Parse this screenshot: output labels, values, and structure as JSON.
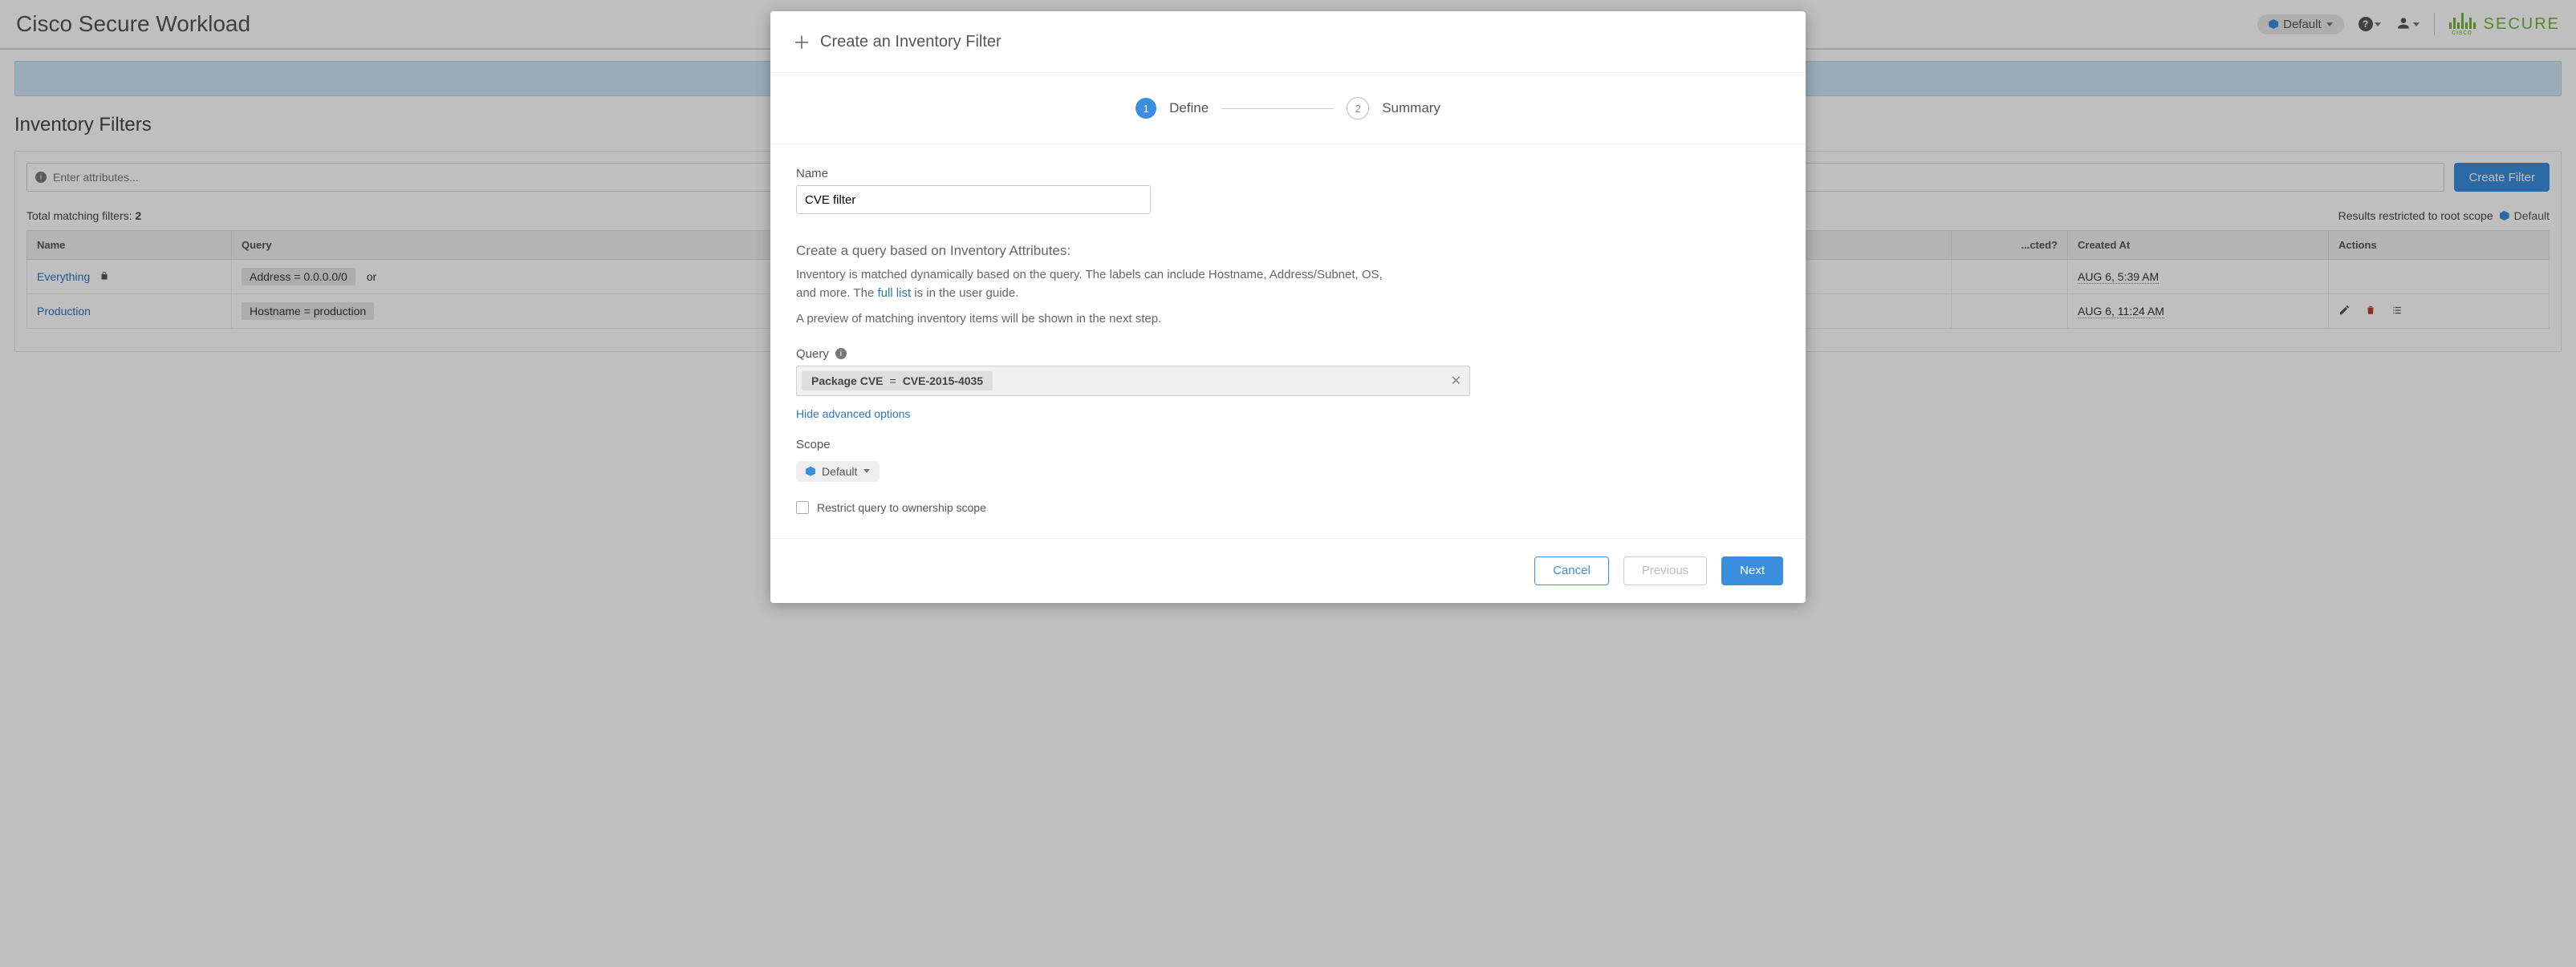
{
  "header": {
    "product": "Cisco Secure Workload",
    "scope": "Default",
    "secure_word": "SECURE",
    "cisco_word": "cisco"
  },
  "page": {
    "title": "Inventory Filters",
    "attr_placeholder": "Enter attributes...",
    "create_button": "Create Filter",
    "total_label": "Total matching filters: ",
    "total_count": "2",
    "results_label": "Results restricted to root scope",
    "results_scope": "Default"
  },
  "table": {
    "columns": {
      "name": "Name",
      "query": "Query",
      "restricted": "...cted?",
      "created": "Created At",
      "actions": "Actions"
    },
    "rows": [
      {
        "name": "Everything",
        "locked": true,
        "query_chips": [
          "Address = 0.0.0.0/0"
        ],
        "query_suffix": "or",
        "created": "AUG 6, 5:39 AM",
        "actions": false
      },
      {
        "name": "Production",
        "locked": false,
        "query_chips": [
          "Hostname = production"
        ],
        "query_suffix": "",
        "created": "AUG 6, 11:24 AM",
        "actions": true
      }
    ]
  },
  "modal": {
    "title": "Create an Inventory Filter",
    "steps": {
      "s1": "Define",
      "s2": "Summary",
      "n1": "1",
      "n2": "2"
    },
    "name_label": "Name",
    "name_value": "CVE filter",
    "section_head": "Create a query based on Inventory Attributes:",
    "explain1": "Inventory is matched dynamically based on the query. The labels can include Hostname, Address/Subnet, OS, and more. The ",
    "full_list": "full list",
    "explain2": " is in the user guide.",
    "preview": "A preview of matching inventory items will be shown in the next step.",
    "query_label": "Query",
    "token_key": "Package CVE",
    "token_op": "=",
    "token_val": "CVE-2015-4035",
    "advanced": "Hide advanced options",
    "scope_label": "Scope",
    "scope_value": "Default",
    "restrict": "Restrict query to ownership scope",
    "cancel": "Cancel",
    "previous": "Previous",
    "next": "Next"
  }
}
